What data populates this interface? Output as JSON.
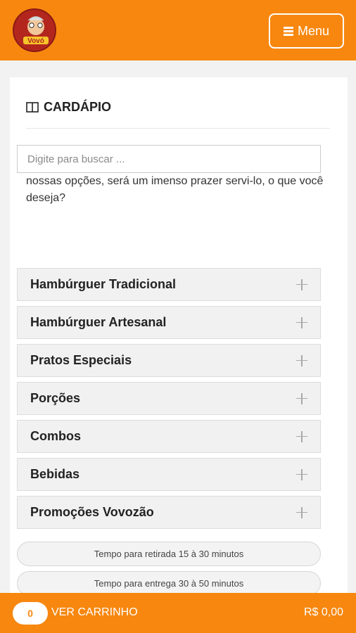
{
  "header": {
    "logo_text": "Vovó",
    "menu_label": "Menu"
  },
  "menu": {
    "title": "CARDÁPIO",
    "intro": "Vamos lá, navegue pelo nosso cardápio e conheça todas nossas opções, será um imenso prazer servi-lo, o que você deseja?",
    "search_placeholder": "Digite para buscar ...",
    "categories": [
      "Hambúrguer Tradicional",
      "Hambúrguer Artesanal",
      "Pratos Especiais",
      "Porções",
      "Combos",
      "Bebidas",
      "Promoções Vovozão"
    ],
    "pickup_time": "Tempo para retirada 15 à 30 minutos",
    "delivery_time": "Tempo para entrega 30 à 50 minutos"
  },
  "cart": {
    "count": "0",
    "label": "VER CARRINHO",
    "total": "R$ 0,00"
  },
  "colors": {
    "brand": "#f7870f",
    "logo": "#b3261e"
  },
  "icons": [
    "hamburger-menu-icon",
    "book-icon",
    "plus-icon"
  ]
}
